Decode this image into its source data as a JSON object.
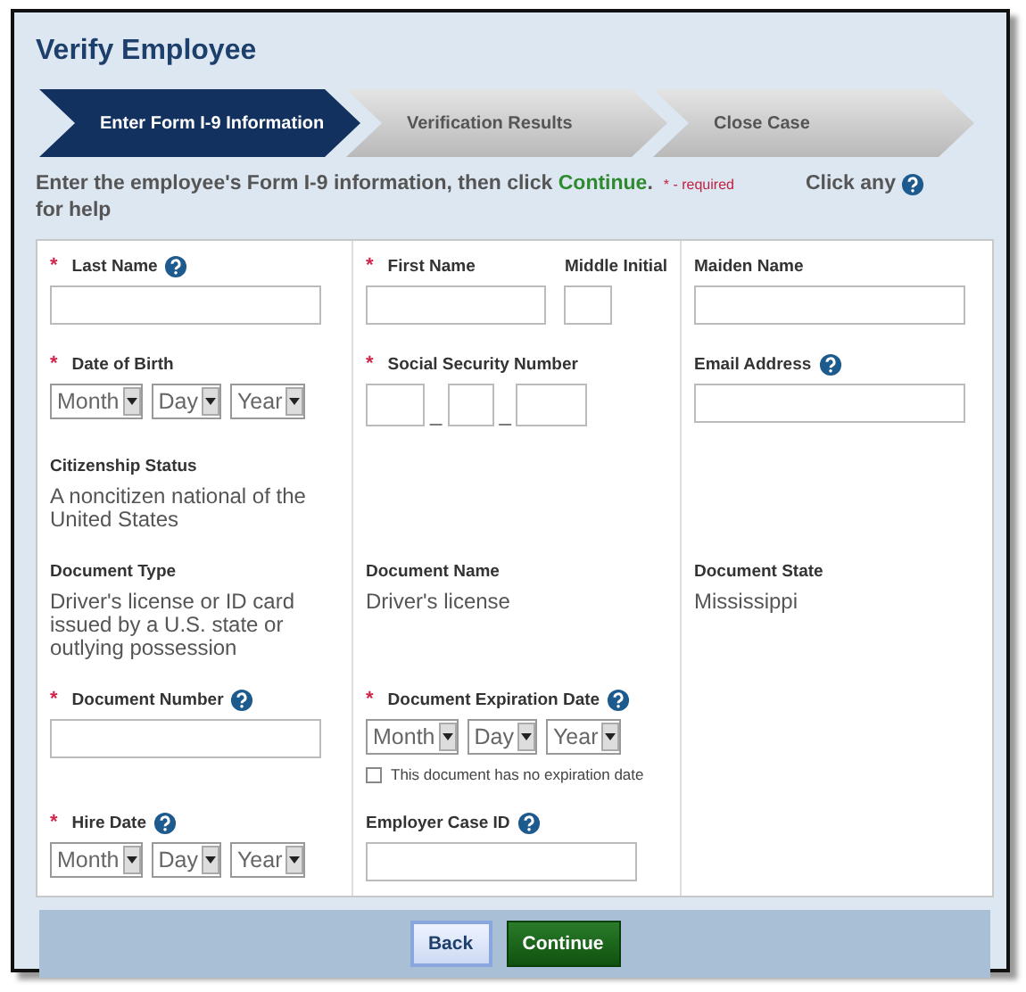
{
  "title": "Verify Employee",
  "steps": [
    {
      "label": "Enter Form I-9 Information",
      "selected": true
    },
    {
      "label": "Verification Results",
      "selected": false
    },
    {
      "label": "Close Case",
      "selected": false
    }
  ],
  "instructions": {
    "text": "Enter the employee's Form I-9 information, then click **Continue**.",
    "required_legend": "* - required",
    "help_before": "Click any",
    "help_after": "for help"
  },
  "required_mark": "*",
  "form_rows": [
    [
      {
        "fields": [
          {
            "kind": "text",
            "label": "Last Name",
            "required": true,
            "help": true
          }
        ]
      },
      {
        "fields": [
          {
            "kind": "text",
            "label": "First Name",
            "required": true,
            "help": false
          },
          {
            "kind": "short_text",
            "label": "Middle Initial",
            "required": false,
            "help": false
          }
        ]
      },
      {
        "fields": [
          {
            "kind": "text",
            "label": "Maiden Name",
            "required": false,
            "help": false
          }
        ]
      }
    ],
    [
      {
        "fields": [
          {
            "kind": "date",
            "label": "Date of Birth",
            "required": true,
            "help": false,
            "selects": [
              "Month",
              "Day",
              "Year"
            ]
          }
        ]
      },
      {
        "fields": [
          {
            "kind": "ssn",
            "label": "Social Security Number",
            "required": true,
            "help": false,
            "separators": [
              "_",
              "_"
            ]
          }
        ]
      },
      {
        "fields": [
          {
            "kind": "text",
            "label": "Email Address",
            "required": false,
            "help": true
          }
        ]
      }
    ],
    [
      {
        "fields": [
          {
            "kind": "readonly",
            "label": "Citizenship Status",
            "value": "A noncitizen national of the United States"
          }
        ]
      },
      {},
      {}
    ],
    [
      {
        "fields": [
          {
            "kind": "readonly",
            "label": "Document Type",
            "value": "Driver's license or ID card issued by a U.S. state or outlying possession"
          }
        ]
      },
      {
        "fields": [
          {
            "kind": "readonly",
            "label": "Document Name",
            "value": "Driver's license"
          }
        ]
      },
      {
        "fields": [
          {
            "kind": "readonly",
            "label": "Document State",
            "value": "Mississippi"
          }
        ]
      }
    ],
    [
      {
        "fields": [
          {
            "kind": "text",
            "label": "Document Number",
            "required": true,
            "help": true
          }
        ]
      },
      {
        "fields": [
          {
            "kind": "date",
            "label": "Document Expiration Date",
            "required": true,
            "help": true,
            "selects": [
              "Month",
              "Day",
              "Year"
            ],
            "checkbox": {
              "label": "This document has no expiration date",
              "checked": false
            }
          }
        ]
      },
      {}
    ],
    [
      {
        "fields": [
          {
            "kind": "date",
            "label": "Hire Date",
            "required": true,
            "help": true,
            "selects": [
              "Month",
              "Day",
              "Year"
            ]
          }
        ]
      },
      {
        "fields": [
          {
            "kind": "text",
            "label": "Employer Case ID",
            "required": false,
            "help": true
          }
        ]
      },
      {}
    ]
  ],
  "buttons": [
    {
      "kind": "secondary",
      "label": "Back"
    },
    {
      "kind": "primary",
      "label": "Continue"
    }
  ]
}
